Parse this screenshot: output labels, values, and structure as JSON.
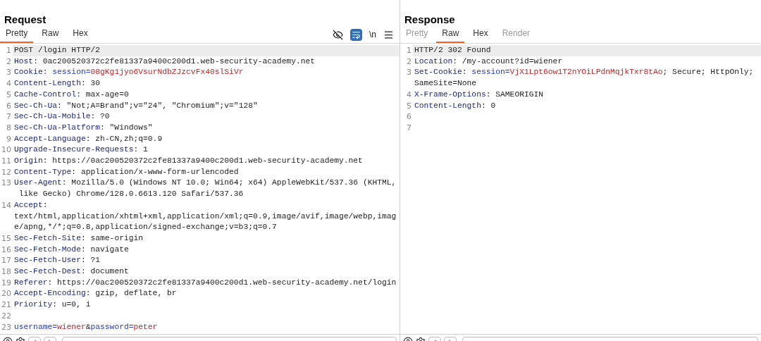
{
  "request": {
    "title": "Request",
    "tabs": [
      {
        "label": "Pretty",
        "selected": true,
        "disabled": false
      },
      {
        "label": "Raw",
        "selected": false,
        "disabled": false
      },
      {
        "label": "Hex",
        "selected": false,
        "disabled": false
      }
    ],
    "toolbar": {
      "newline_label": "\\n",
      "wrap_on": true
    },
    "rows": [
      {
        "number": "1",
        "highlighted": true,
        "segments": [
          {
            "kind": "plain",
            "text": "POST /login HTTP/2"
          }
        ]
      },
      {
        "number": "2",
        "highlighted": false,
        "segments": [
          {
            "kind": "name",
            "text": "Host"
          },
          {
            "kind": "plain",
            "text": ": 0ac200520372c2fe81337a9400c200d1.web-security-academy.net"
          }
        ]
      },
      {
        "number": "3",
        "highlighted": false,
        "segments": [
          {
            "kind": "name",
            "text": "Cookie"
          },
          {
            "kind": "plain",
            "text": ": "
          },
          {
            "kind": "param",
            "text": "session"
          },
          {
            "kind": "param",
            "text": "="
          },
          {
            "kind": "value",
            "text": "08gKg1jyo6VsurNdbZJzcvFx40slSiVr"
          }
        ]
      },
      {
        "number": "4",
        "highlighted": false,
        "segments": [
          {
            "kind": "name",
            "text": "Content-Length"
          },
          {
            "kind": "plain",
            "text": ": 30"
          }
        ]
      },
      {
        "number": "5",
        "highlighted": false,
        "segments": [
          {
            "kind": "name",
            "text": "Cache-Control"
          },
          {
            "kind": "plain",
            "text": ": max-age=0"
          }
        ]
      },
      {
        "number": "6",
        "highlighted": false,
        "segments": [
          {
            "kind": "name",
            "text": "Sec-Ch-Ua"
          },
          {
            "kind": "plain",
            "text": ": \"Not;A=Brand\";v=\"24\", \"Chromium\";v=\"128\""
          }
        ]
      },
      {
        "number": "7",
        "highlighted": false,
        "segments": [
          {
            "kind": "name",
            "text": "Sec-Ch-Ua-Mobile"
          },
          {
            "kind": "plain",
            "text": ": ?0"
          }
        ]
      },
      {
        "number": "8",
        "highlighted": false,
        "segments": [
          {
            "kind": "name",
            "text": "Sec-Ch-Ua-Platform"
          },
          {
            "kind": "plain",
            "text": ": \"Windows\""
          }
        ]
      },
      {
        "number": "9",
        "highlighted": false,
        "segments": [
          {
            "kind": "name",
            "text": "Accept-Language"
          },
          {
            "kind": "plain",
            "text": ": zh-CN,zh;q=0.9"
          }
        ]
      },
      {
        "number": "10",
        "highlighted": false,
        "segments": [
          {
            "kind": "name",
            "text": "Upgrade-Insecure-Requests"
          },
          {
            "kind": "plain",
            "text": ": 1"
          }
        ]
      },
      {
        "number": "11",
        "highlighted": false,
        "segments": [
          {
            "kind": "name",
            "text": "Origin"
          },
          {
            "kind": "plain",
            "text": ": https://0ac200520372c2fe81337a9400c200d1.web-security-academy.net"
          }
        ]
      },
      {
        "number": "12",
        "highlighted": false,
        "segments": [
          {
            "kind": "name",
            "text": "Content-Type"
          },
          {
            "kind": "plain",
            "text": ": application/x-www-form-urlencoded"
          }
        ]
      },
      {
        "number": "13",
        "highlighted": false,
        "segments": [
          {
            "kind": "name",
            "text": "User-Agent"
          },
          {
            "kind": "plain",
            "text": ": Mozilla/5.0 (Windows NT 10.0; Win64; x64) AppleWebKit/537.36 (KHTML,"
          }
        ]
      },
      {
        "highlighted": false,
        "segments": [
          {
            "kind": "plain",
            "text": " like Gecko) Chrome/128.0.6613.120 Safari/537.36"
          }
        ]
      },
      {
        "number": "14",
        "highlighted": false,
        "segments": [
          {
            "kind": "name",
            "text": "Accept"
          },
          {
            "kind": "plain",
            "text": ":"
          }
        ]
      },
      {
        "highlighted": false,
        "segments": [
          {
            "kind": "plain",
            "text": "text/html,application/xhtml+xml,application/xml;q=0.9,image/avif,image/webp,imag"
          }
        ]
      },
      {
        "highlighted": false,
        "segments": [
          {
            "kind": "plain",
            "text": "e/apng,*/*;q=0.8,application/signed-exchange;v=b3;q=0.7"
          }
        ]
      },
      {
        "number": "15",
        "highlighted": false,
        "segments": [
          {
            "kind": "name",
            "text": "Sec-Fetch-Site"
          },
          {
            "kind": "plain",
            "text": ": same-origin"
          }
        ]
      },
      {
        "number": "16",
        "highlighted": false,
        "segments": [
          {
            "kind": "name",
            "text": "Sec-Fetch-Mode"
          },
          {
            "kind": "plain",
            "text": ": navigate"
          }
        ]
      },
      {
        "number": "17",
        "highlighted": false,
        "segments": [
          {
            "kind": "name",
            "text": "Sec-Fetch-User"
          },
          {
            "kind": "plain",
            "text": ": ?1"
          }
        ]
      },
      {
        "number": "18",
        "highlighted": false,
        "segments": [
          {
            "kind": "name",
            "text": "Sec-Fetch-Dest"
          },
          {
            "kind": "plain",
            "text": ": document"
          }
        ]
      },
      {
        "number": "19",
        "highlighted": false,
        "segments": [
          {
            "kind": "name",
            "text": "Referer"
          },
          {
            "kind": "plain",
            "text": ": https://0ac200520372c2fe81337a9400c200d1.web-security-academy.net/login"
          }
        ]
      },
      {
        "number": "20",
        "highlighted": false,
        "segments": [
          {
            "kind": "name",
            "text": "Accept-Encoding"
          },
          {
            "kind": "plain",
            "text": ": gzip, deflate, br"
          }
        ]
      },
      {
        "number": "21",
        "highlighted": false,
        "segments": [
          {
            "kind": "name",
            "text": "Priority"
          },
          {
            "kind": "plain",
            "text": ": u=0, i"
          }
        ]
      },
      {
        "number": "22",
        "highlighted": false,
        "segments": []
      },
      {
        "number": "23",
        "highlighted": false,
        "segments": [
          {
            "kind": "param",
            "text": "username"
          },
          {
            "kind": "param",
            "text": "="
          },
          {
            "kind": "value",
            "text": "wiener"
          },
          {
            "kind": "plain",
            "text": "&"
          },
          {
            "kind": "param",
            "text": "password"
          },
          {
            "kind": "param",
            "text": "="
          },
          {
            "kind": "value",
            "text": "peter"
          }
        ]
      }
    ]
  },
  "response": {
    "title": "Response",
    "tabs": [
      {
        "label": "Pretty",
        "selected": false,
        "disabled": true
      },
      {
        "label": "Raw",
        "selected": true,
        "disabled": false
      },
      {
        "label": "Hex",
        "selected": false,
        "disabled": false
      },
      {
        "label": "Render",
        "selected": false,
        "disabled": true
      }
    ],
    "rows": [
      {
        "number": "1",
        "highlighted": true,
        "segments": [
          {
            "kind": "plain",
            "text": "HTTP/2 302 Found"
          }
        ]
      },
      {
        "number": "2",
        "highlighted": false,
        "segments": [
          {
            "kind": "name",
            "text": "Location"
          },
          {
            "kind": "plain",
            "text": ": /my-account?id=wiener"
          }
        ]
      },
      {
        "number": "3",
        "highlighted": false,
        "segments": [
          {
            "kind": "name",
            "text": "Set-Cookie"
          },
          {
            "kind": "plain",
            "text": ": "
          },
          {
            "kind": "param",
            "text": "session"
          },
          {
            "kind": "param",
            "text": "="
          },
          {
            "kind": "value",
            "text": "VjX1Lpt6ow1T2nYOiLPdnMqjkTxr8tAo"
          },
          {
            "kind": "plain",
            "text": "; Secure; HttpOnly;"
          }
        ]
      },
      {
        "highlighted": false,
        "segments": [
          {
            "kind": "plain",
            "text": "SameSite=None"
          }
        ]
      },
      {
        "number": "4",
        "highlighted": false,
        "segments": [
          {
            "kind": "name",
            "text": "X-Frame-Options"
          },
          {
            "kind": "plain",
            "text": ": SAMEORIGIN"
          }
        ]
      },
      {
        "number": "5",
        "highlighted": false,
        "segments": [
          {
            "kind": "name",
            "text": "Content-Length"
          },
          {
            "kind": "plain",
            "text": ": 0"
          }
        ]
      },
      {
        "number": "6",
        "highlighted": false,
        "segments": []
      },
      {
        "number": "7",
        "highlighted": false,
        "segments": []
      }
    ]
  }
}
